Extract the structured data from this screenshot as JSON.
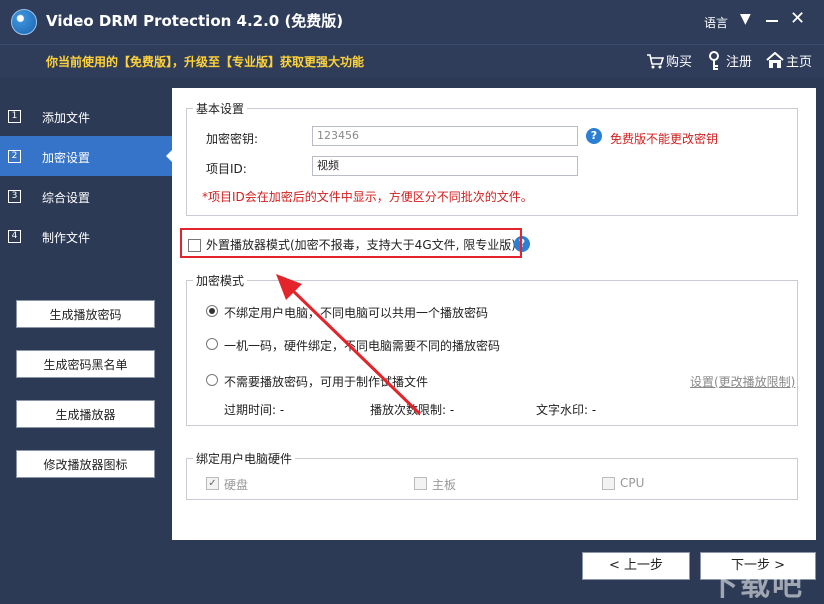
{
  "window": {
    "title": "Video DRM Protection 4.2.0 (免费版)",
    "language": "语言",
    "arrow": "▼",
    "close": "✕"
  },
  "promo": {
    "text": "你当前使用的【免费版】，升级至【专业版】获取更强大功能",
    "buy": "购买",
    "register": "注册",
    "home": "主页"
  },
  "sidebar": {
    "items": [
      {
        "num": "1",
        "label": "添加文件"
      },
      {
        "num": "2",
        "label": "加密设置"
      },
      {
        "num": "3",
        "label": "综合设置"
      },
      {
        "num": "4",
        "label": "制作文件"
      }
    ],
    "buttons": {
      "gen_password": "生成播放密码",
      "gen_blacklist": "生成密码黑名单",
      "gen_player": "生成播放器",
      "change_icon": "修改播放器图标"
    }
  },
  "basic": {
    "legend": "基本设置",
    "key_label": "加密密钥:",
    "key_value": "123456",
    "key_warning": "免费版不能更改密钥",
    "id_label": "项目ID:",
    "id_value": "视频",
    "note": "*项目ID会在加密后的文件中显示，方便区分不同批次的文件。"
  },
  "external_player": {
    "label": "外置播放器模式(加密不报毒，支持大于4G文件, 限专业版)",
    "checked": false
  },
  "encrypt_mode": {
    "legend": "加密模式",
    "options": [
      {
        "label": "不绑定用户电脑，不同电脑可以共用一个播放密码",
        "selected": true
      },
      {
        "label": "一机一码，硬件绑定，不同电脑需要不同的播放密码",
        "selected": false
      },
      {
        "label": "不需要播放密码，可用于制作试播文件",
        "selected": false
      }
    ],
    "settings_link": "设置(更改播放限制)",
    "expire": "过期时间: -",
    "play_limit": "播放次数限制: -",
    "text_watermark": "文字水印: -"
  },
  "hardware": {
    "legend": "绑定用户电脑硬件",
    "items": [
      {
        "label": "硬盘",
        "checked": true
      },
      {
        "label": "主板",
        "checked": false
      },
      {
        "label": "CPU",
        "checked": false
      }
    ]
  },
  "nav": {
    "prev": "< 上一步",
    "next": "下一步 >"
  },
  "watermark": "下载吧",
  "colors": {
    "background": "#2d3a55",
    "accent": "#3574c9",
    "promo_text": "#ffd23a",
    "warning": "#d21e1e",
    "highlight": "#e3242b"
  }
}
